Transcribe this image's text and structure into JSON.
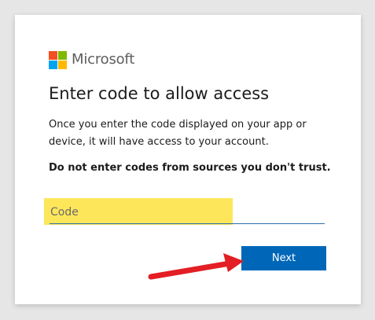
{
  "brand": {
    "name": "Microsoft",
    "logo_colors": [
      "#f25022",
      "#7fba00",
      "#00a4ef",
      "#ffb900"
    ]
  },
  "heading": "Enter code to allow access",
  "description": "Once you enter the code displayed on your app or device, it will have access to your account.",
  "warning": "Do not enter codes from sources you don't trust.",
  "code_field": {
    "placeholder": "Code",
    "value": ""
  },
  "next_button": {
    "label": "Next",
    "color": "#0067b8"
  },
  "annotation": {
    "highlight_color": "#fde65a",
    "arrow_color": "#e31e24"
  }
}
